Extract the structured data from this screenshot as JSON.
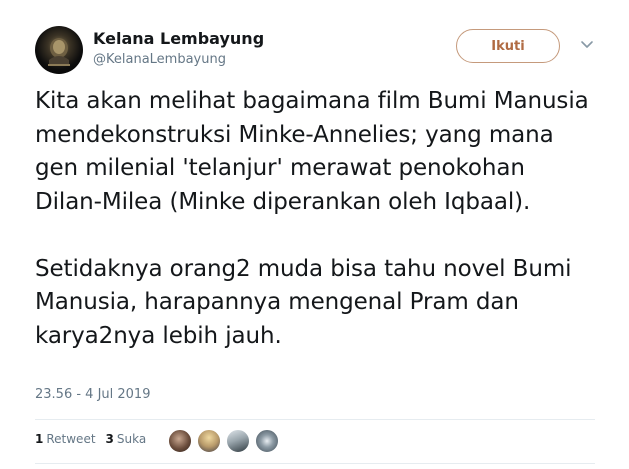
{
  "author": {
    "display_name": "Kelana Lembayung",
    "handle": "@KelanaLembayung"
  },
  "follow_button": {
    "label": "Ikuti"
  },
  "menu_icon": "chevron-down-icon",
  "tweet": {
    "paragraph_1": "Kita akan melihat bagaimana film Bumi Manusia mendekonstruksi Minke-Annelies; yang mana gen milenial 'telanjur' merawat penokohan Dilan-Milea (Minke diperankan oleh Iqbaal).",
    "paragraph_2": "Setidaknya orang2 muda bisa tahu novel Bumi Manusia, harapannya mengenal Pram dan karya2nya lebih jauh.",
    "timestamp": "23.56 - 4 Jul 2019"
  },
  "stats": {
    "retweet_count": "1",
    "retweet_label": "Retweet",
    "like_count": "3",
    "like_label": "Suka"
  },
  "colors": {
    "follow_accent": "#b06b43",
    "follow_border": "#c59a7c",
    "muted_text": "#657786",
    "divider": "#e6ecf0"
  }
}
